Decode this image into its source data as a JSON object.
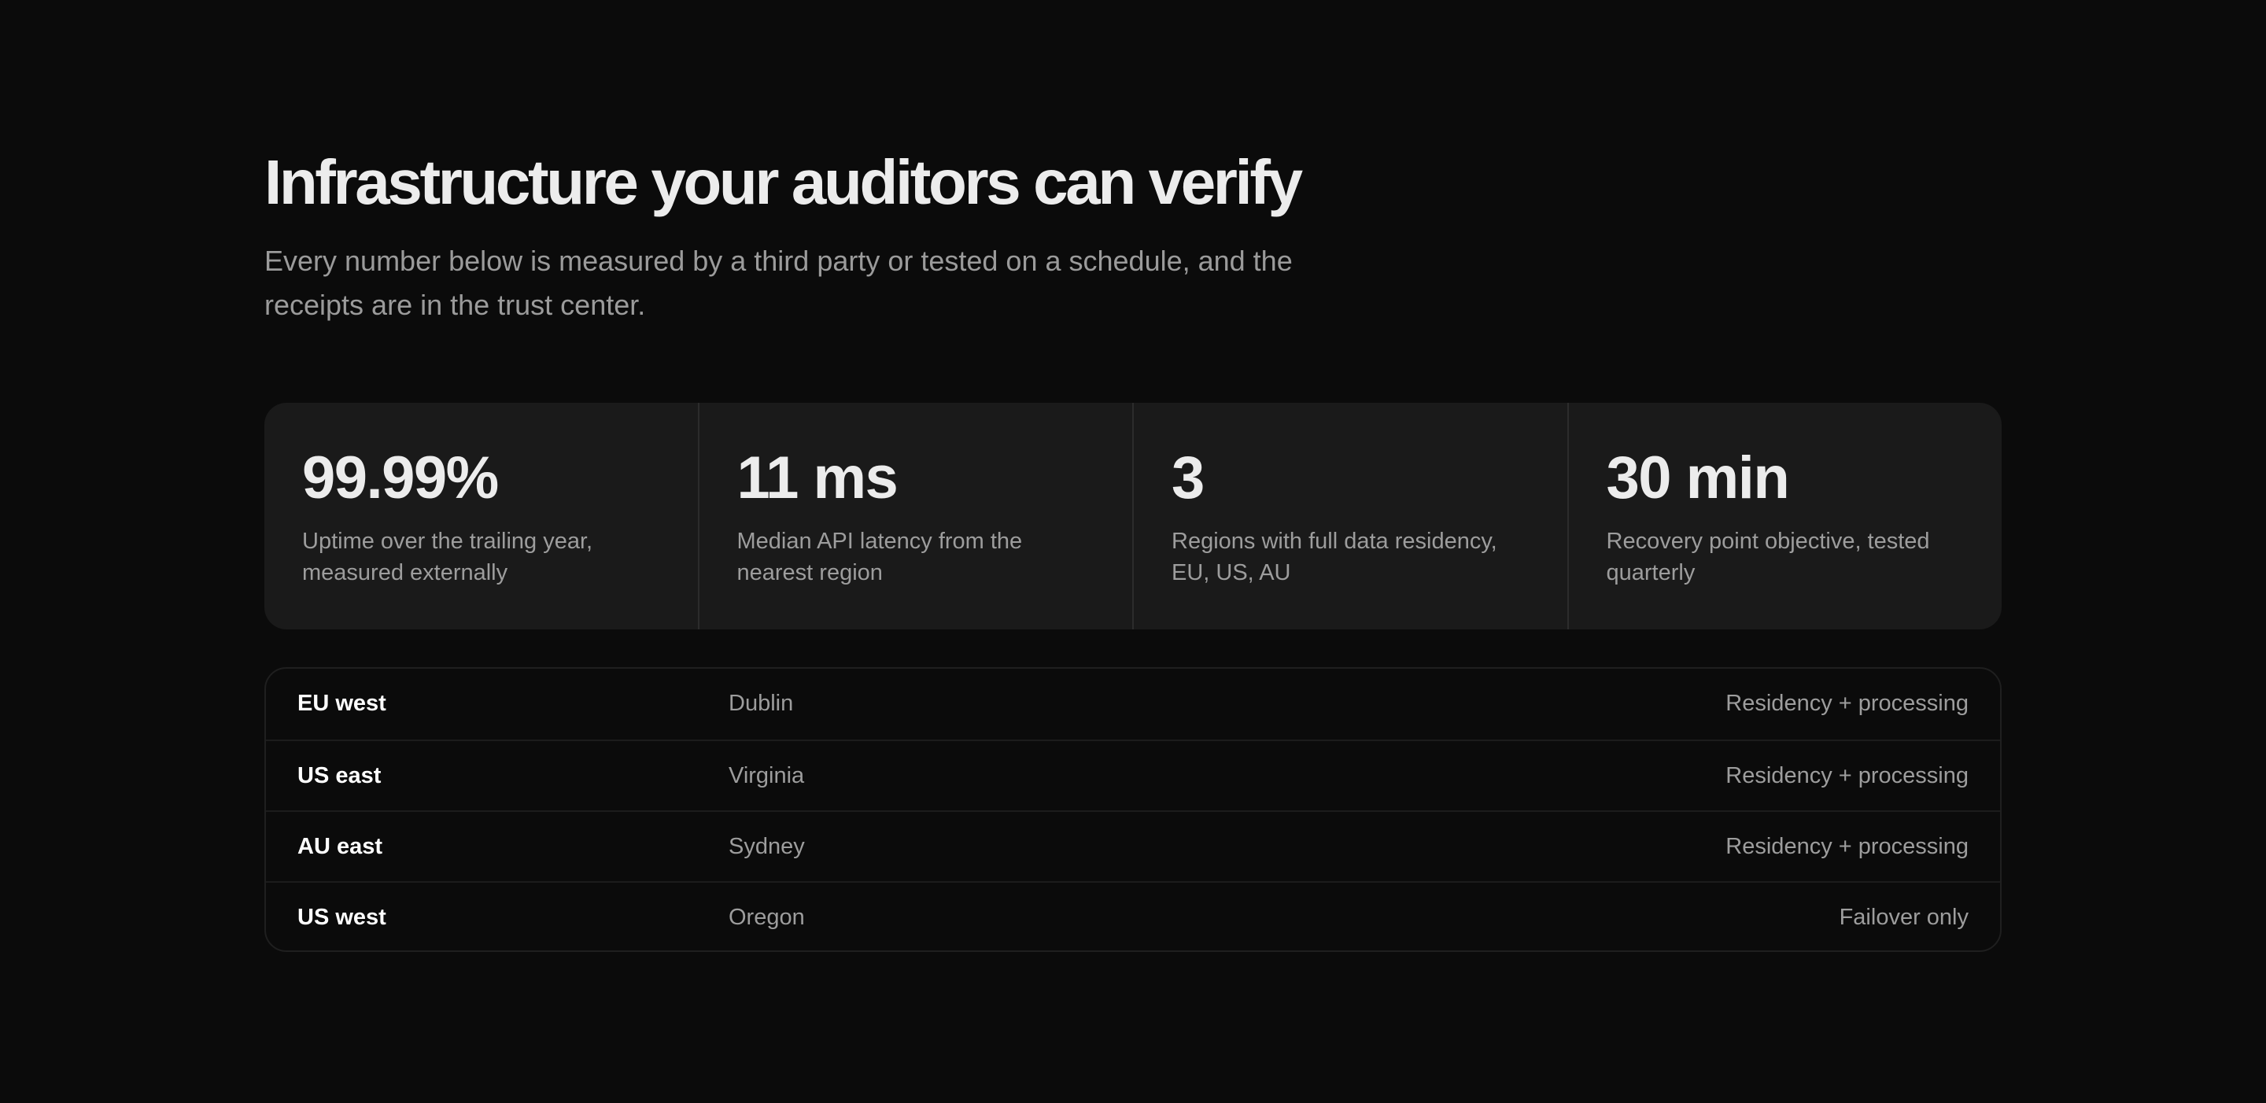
{
  "header": {
    "title": "Infrastructure your auditors can verify",
    "subtitle": "Every number below is measured by a third party or tested on a schedule, and the receipts are in the trust center."
  },
  "stats": [
    {
      "value": "99.99%",
      "description": "Uptime over the trailing year, measured externally"
    },
    {
      "value": "11 ms",
      "description": "Median API latency from the nearest region"
    },
    {
      "value": "3",
      "description": "Regions with full data residency, EU, US, AU"
    },
    {
      "value": "30 min",
      "description": "Recovery point objective, tested quarterly"
    }
  ],
  "regions": [
    {
      "name": "EU west",
      "city": "Dublin",
      "role": "Residency + processing"
    },
    {
      "name": "US east",
      "city": "Virginia",
      "role": "Residency + processing"
    },
    {
      "name": "AU east",
      "city": "Sydney",
      "role": "Residency + processing"
    },
    {
      "name": "US west",
      "city": "Oregon",
      "role": "Failover only"
    }
  ],
  "colors": {
    "background": "#0b0b0b",
    "card": "#1a1a1a",
    "text_primary": "#ececec",
    "text_muted": "#9d9d9d"
  }
}
